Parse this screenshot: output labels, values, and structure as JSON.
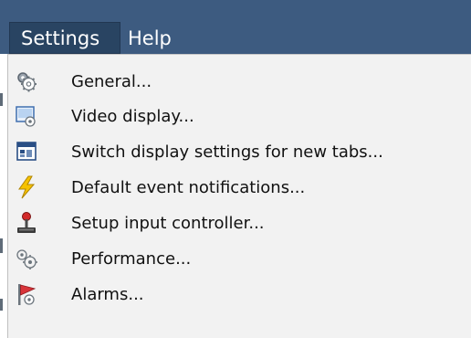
{
  "menubar": {
    "settings_label": "Settings",
    "help_label": "Help"
  },
  "settings_menu": {
    "items": [
      {
        "label": "General...",
        "icon": "gear-icon"
      },
      {
        "label": "Video display...",
        "icon": "video-display-icon"
      },
      {
        "label": "Switch display settings for new tabs...",
        "icon": "switch-display-icon"
      },
      {
        "label": "Default event notifications...",
        "icon": "lightning-icon"
      },
      {
        "label": "Setup input controller...",
        "icon": "joystick-icon"
      },
      {
        "label": "Performance...",
        "icon": "performance-gears-icon"
      },
      {
        "label": "Alarms...",
        "icon": "alarm-flag-icon"
      }
    ]
  },
  "colors": {
    "menubar": "#3d5b80",
    "menubar_selected": "#294462",
    "menu_background": "#f2f2f2"
  }
}
